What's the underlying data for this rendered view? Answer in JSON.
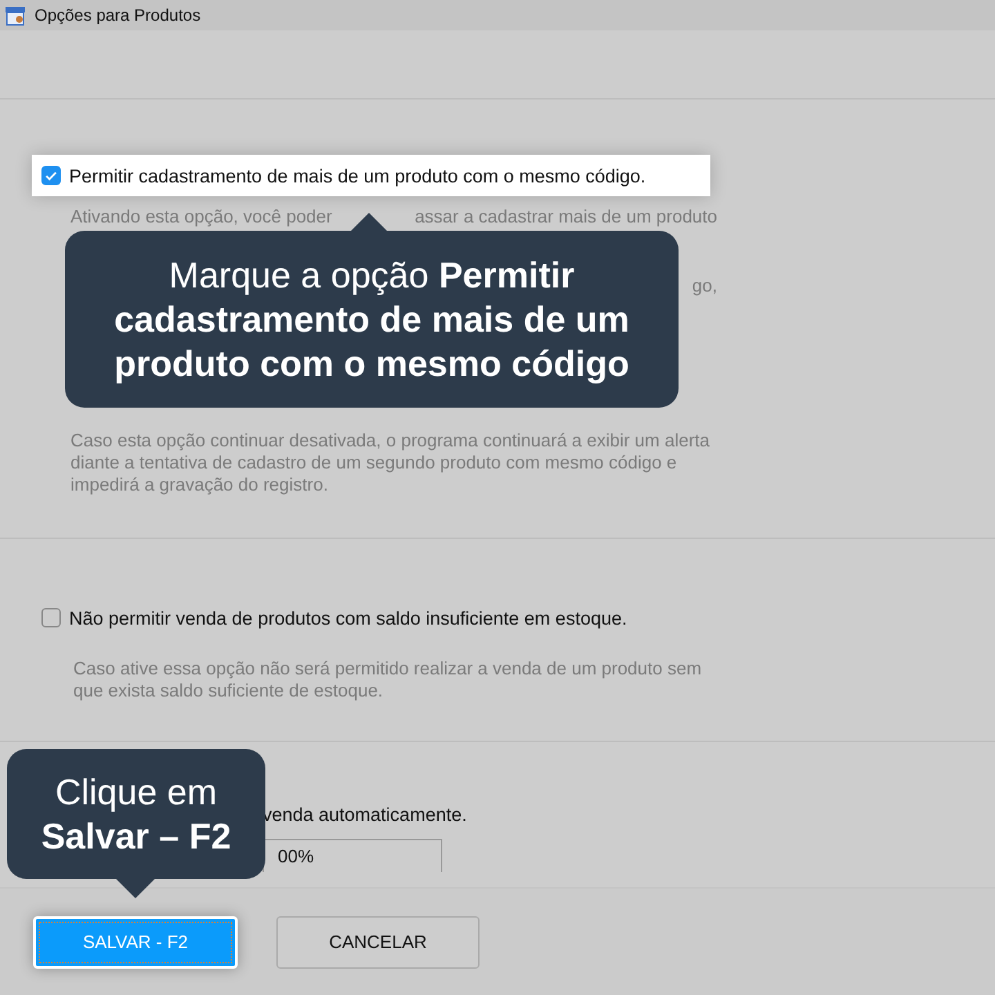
{
  "window": {
    "title": "Opções para Produtos"
  },
  "options": [
    {
      "kind": "checkbox",
      "checked": true,
      "highlighted": true,
      "label": "Permitir cadastramento de mais de um produto com o mesmo código.",
      "description_fragments": [
        [
          "Ativando esta opção, você poder",
          "assar a cadastrar mais de um produto"
        ],
        [
          "go,"
        ]
      ],
      "paragraph": "Caso esta opção continuar desativada, o programa continuará a exibir um alerta diante a tentativa de cadastro de um segundo produto com mesmo código e impedirá a gravação do registro."
    },
    {
      "kind": "checkbox",
      "checked": false,
      "highlighted": false,
      "label": "Não permitir venda de produtos com saldo insuficiente em estoque.",
      "paragraph": "Caso ative essa opção não será permitido realizar a venda de um produto sem que exista saldo suficiente de estoque."
    },
    {
      "kind": "covered",
      "label": "venda automaticamente.",
      "field_value": "00%"
    }
  ],
  "buttons": [
    {
      "label": "SALVAR - F2",
      "primary": true
    },
    {
      "label": "CANCELAR",
      "primary": false
    }
  ],
  "tooltips": [
    {
      "text": "Marque a opção **Permitir cadastramento de mais de um produto com o mesmo código**"
    },
    {
      "text": "Clique em **Salvar – F2**"
    }
  ]
}
